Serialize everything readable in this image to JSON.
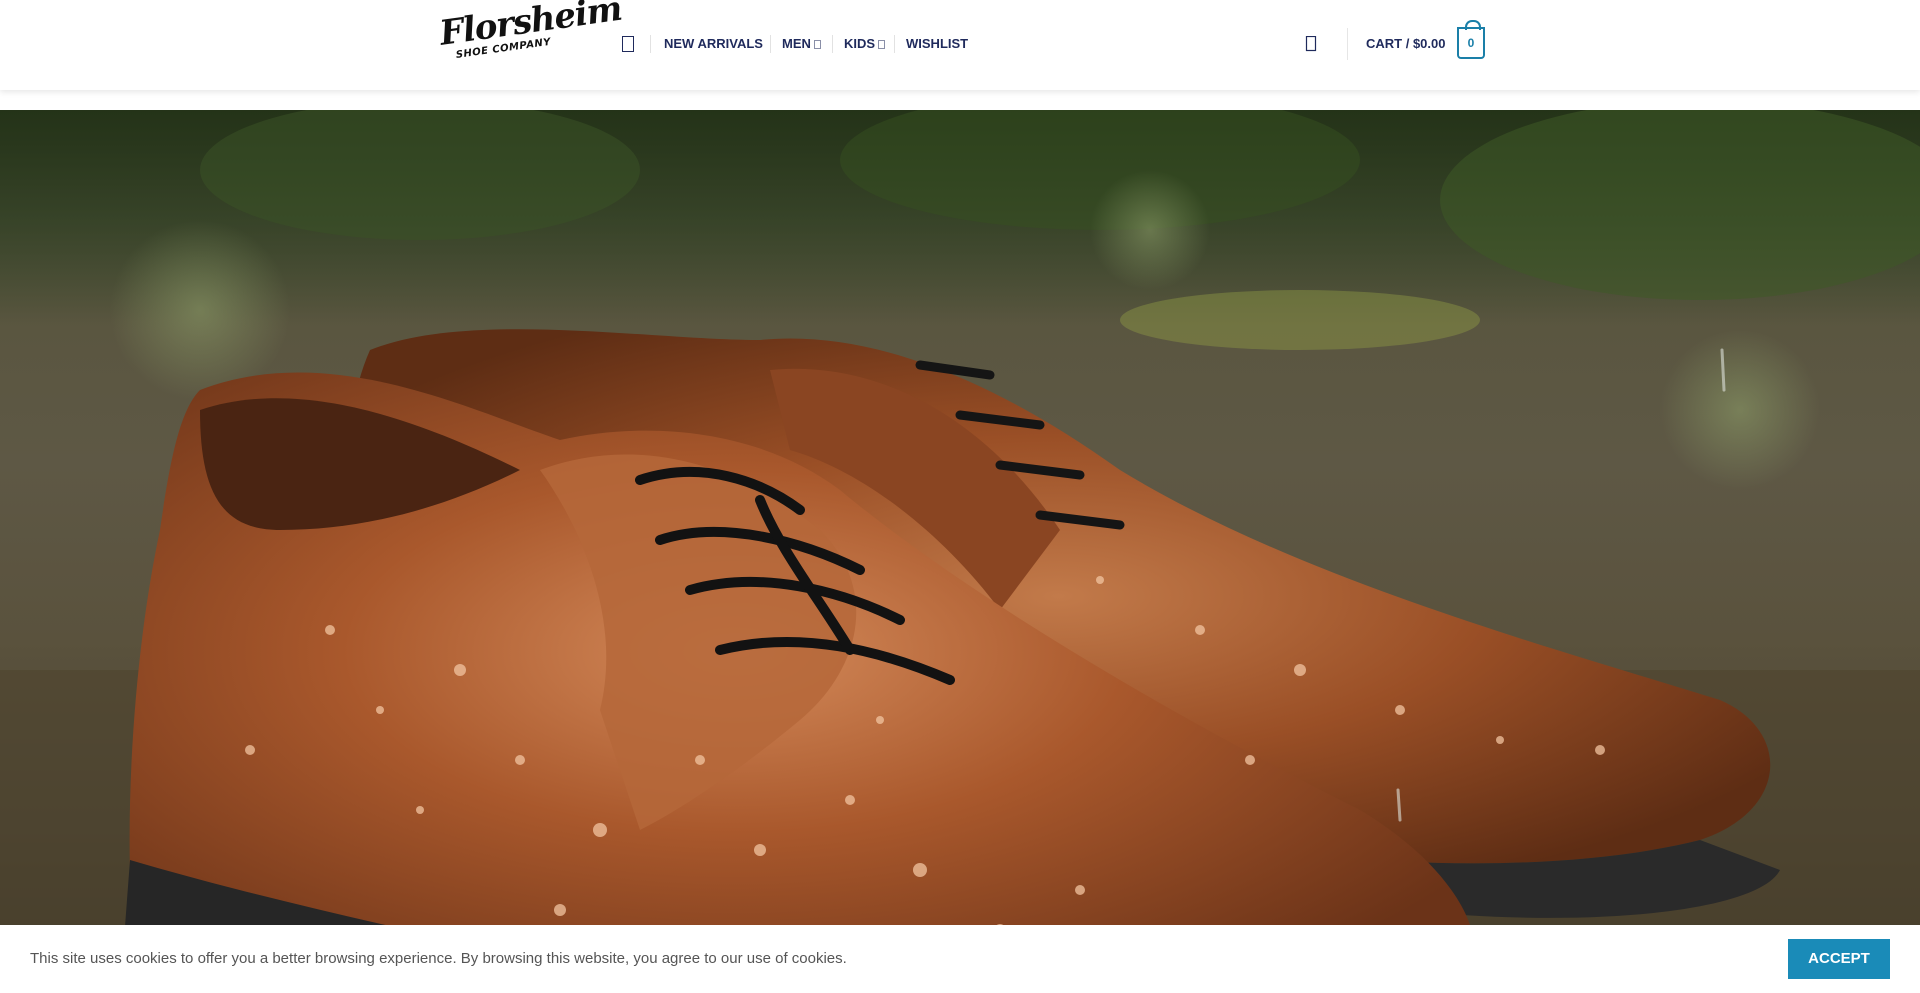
{
  "brand": {
    "logo_script": "Florsheim",
    "logo_subtitle": "SHOE COMPANY"
  },
  "nav": {
    "menu_icon": "menu-icon",
    "items": [
      {
        "label": "NEW ARRIVALS",
        "has_dropdown": false
      },
      {
        "label": "MEN",
        "has_dropdown": true
      },
      {
        "label": "KIDS",
        "has_dropdown": true
      },
      {
        "label": "WISHLIST",
        "has_dropdown": false
      }
    ]
  },
  "header_actions": {
    "search_icon": "search-icon",
    "cart_label": "CART / $0.00",
    "cart_count": "0"
  },
  "hero": {
    "image_subject": "brown leather lace-up dress shoes with water droplets in the rain"
  },
  "cookie_banner": {
    "message": "This site uses cookies to offer you a better browsing experience. By browsing this website, you agree to our use of cookies.",
    "accept_label": "ACCEPT"
  },
  "colors": {
    "nav_text": "#1f2a5c",
    "accent": "#1a8bb8",
    "cart_accent": "#1a7fa8",
    "cookie_text": "#555555"
  }
}
